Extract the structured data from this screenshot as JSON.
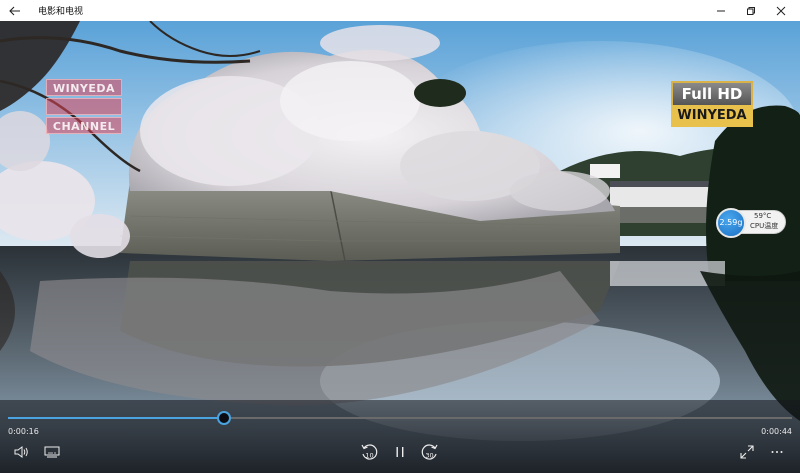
{
  "titlebar": {
    "app_title": "电影和电视",
    "back_icon": "back-arrow-icon",
    "minimize_icon": "minimize-icon",
    "restore_icon": "restore-icon",
    "close_icon": "close-icon"
  },
  "overlays": {
    "watermark_lines": [
      "WINYEDA",
      "",
      "CHANNEL"
    ],
    "fullhd_top": "Full HD",
    "fullhd_bottom": "WINYEDA",
    "cpu_value": "2.59g",
    "cpu_temp": "59°C",
    "cpu_label": "CPU温度"
  },
  "player": {
    "current_time": "0:00:16",
    "total_time": "0:00:44",
    "progress": 0.275,
    "buttons": {
      "volume": "volume-icon",
      "subtitles": "subtitles-icon",
      "skip_back": "skip-back-10-icon",
      "skip_back_label": "10",
      "play_pause": "pause-icon",
      "skip_forward": "skip-forward-30-icon",
      "skip_forward_label": "30",
      "fullscreen": "fullscreen-icon",
      "more": "more-icon"
    }
  },
  "colors": {
    "accent": "#4aa3df",
    "titlebar_bg": "#ffffff"
  }
}
